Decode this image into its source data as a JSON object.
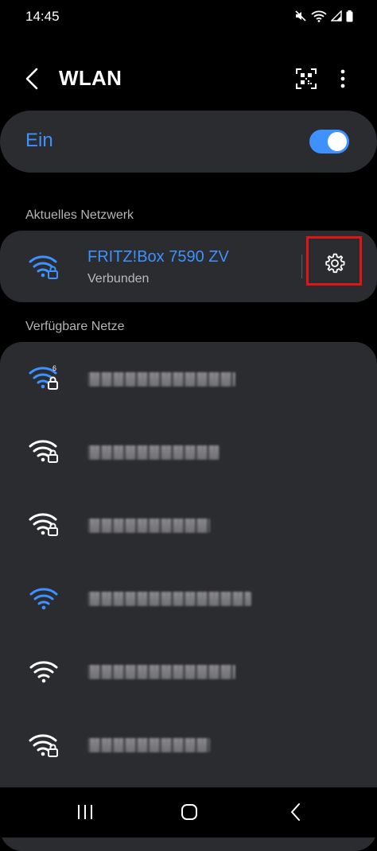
{
  "status_bar": {
    "time": "14:45"
  },
  "header": {
    "title": "WLAN"
  },
  "master_switch": {
    "label": "Ein",
    "state": "on"
  },
  "current_section": {
    "label": "Aktuelles Netzwerk",
    "network": {
      "name": "FRITZ!Box 7590 ZV",
      "status": "Verbunden"
    }
  },
  "available_section": {
    "label": "Verfügbare Netze",
    "networks": [
      {
        "name": "",
        "icon": "wifi-6-secured-icon"
      },
      {
        "name": "",
        "icon": "wifi-secured-icon"
      },
      {
        "name": "",
        "icon": "wifi-secured-icon"
      },
      {
        "name": "",
        "icon": "wifi-open-icon"
      },
      {
        "name": "",
        "icon": "wifi-open-icon"
      },
      {
        "name": "",
        "icon": "wifi-secured-icon"
      }
    ]
  },
  "colors": {
    "accent": "#3e91ff",
    "card": "#2b2c30",
    "highlight": "#e01515"
  }
}
